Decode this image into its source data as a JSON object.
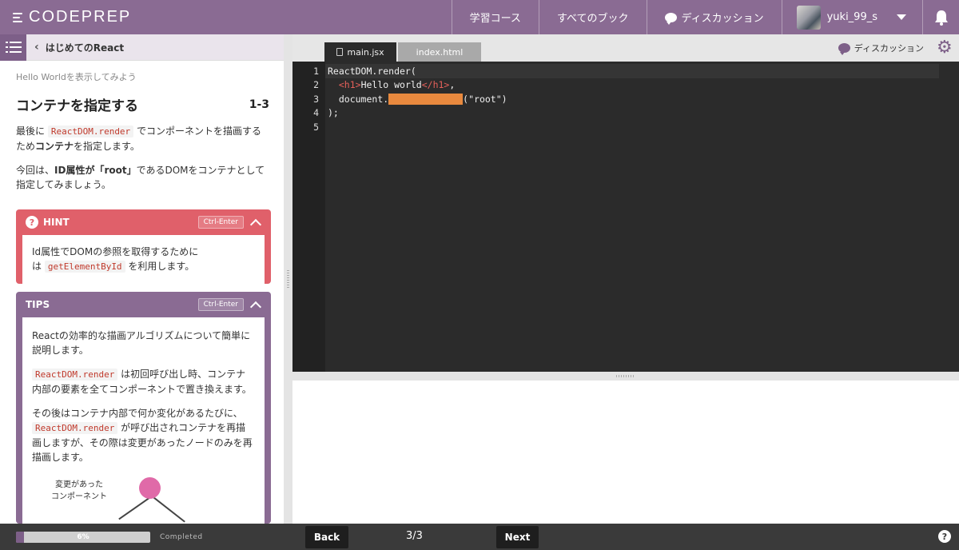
{
  "app": {
    "logo_text": "CODEPREP"
  },
  "nav": {
    "items": [
      {
        "label": "学習コース"
      },
      {
        "label": "すべてのブック"
      },
      {
        "label": "ディスカッション",
        "icon": "speech-bubble-icon"
      }
    ],
    "user": {
      "name": "yuki_99_s"
    },
    "notifications_icon": "bell-icon",
    "accent_color": "#8a6b93"
  },
  "sidebar": {
    "breadcrumb": "はじめてのReact",
    "lesson_subtitle": "Hello Worldを表示してみよう",
    "lesson_title": "コンテナを指定する",
    "lesson_step": "1-3",
    "para1_a": "最後に",
    "para1_code": "ReactDOM.render",
    "para1_b": "でコンポーネントを描画するため",
    "para1_c": "コンテナ",
    "para1_d": "を指定します。",
    "para2_a": "今回は、",
    "para2_b": "ID属性が「root」",
    "para2_c": "であるDOMをコンテナとして指定してみましょう。",
    "hint": {
      "title": "HINT",
      "shortcut": "Ctrl-Enter",
      "text_a": "Id属性でDOMの参照を取得するために",
      "text_b": "は",
      "code": "getElementById",
      "text_c": "を利用します。"
    },
    "tips": {
      "title": "TIPS",
      "shortcut": "Ctrl-Enter",
      "p1": "Reactの効率的な描画アルゴリズムについて簡単に説明します。",
      "p2_code": "ReactDOM.render",
      "p2_text": "は初回呼び出し時、コンテナ内部の要素を全てコンポーネントで置き換えます。",
      "p3_a": "その後はコンテナ内部で何か変化があるたびに、",
      "p3_code": "ReactDOM.render",
      "p3_b": "が呼び出されコンテナを再描画しますが、その際は変更があったノードのみを再描画します。",
      "diagram_label_1": "変更があった",
      "diagram_label_2": "コンポーネント"
    }
  },
  "editor": {
    "tabs": [
      {
        "label": "main.jsx",
        "active": true
      },
      {
        "label": "index.html",
        "active": false
      }
    ],
    "discussion_label": "ディスカッション",
    "settings_icon": "gear-icon",
    "lines": [
      {
        "num": "1",
        "text": "ReactDOM.render("
      },
      {
        "num": "2",
        "tag_open": "<h1>",
        "text": "Hello world",
        "tag_close": "</h1>",
        "tail": ","
      },
      {
        "num": "3",
        "prefix": "document.",
        "suffix": "(\"root\")"
      },
      {
        "num": "4",
        "text": ");"
      },
      {
        "num": "5",
        "text": ""
      }
    ],
    "blank_color": "#e8893e"
  },
  "footer": {
    "progress_percent": 6,
    "progress_label": "6%",
    "completed_label": "Completed",
    "back_label": "Back",
    "page": "3/3",
    "next_label": "Next",
    "help_label": "?"
  }
}
